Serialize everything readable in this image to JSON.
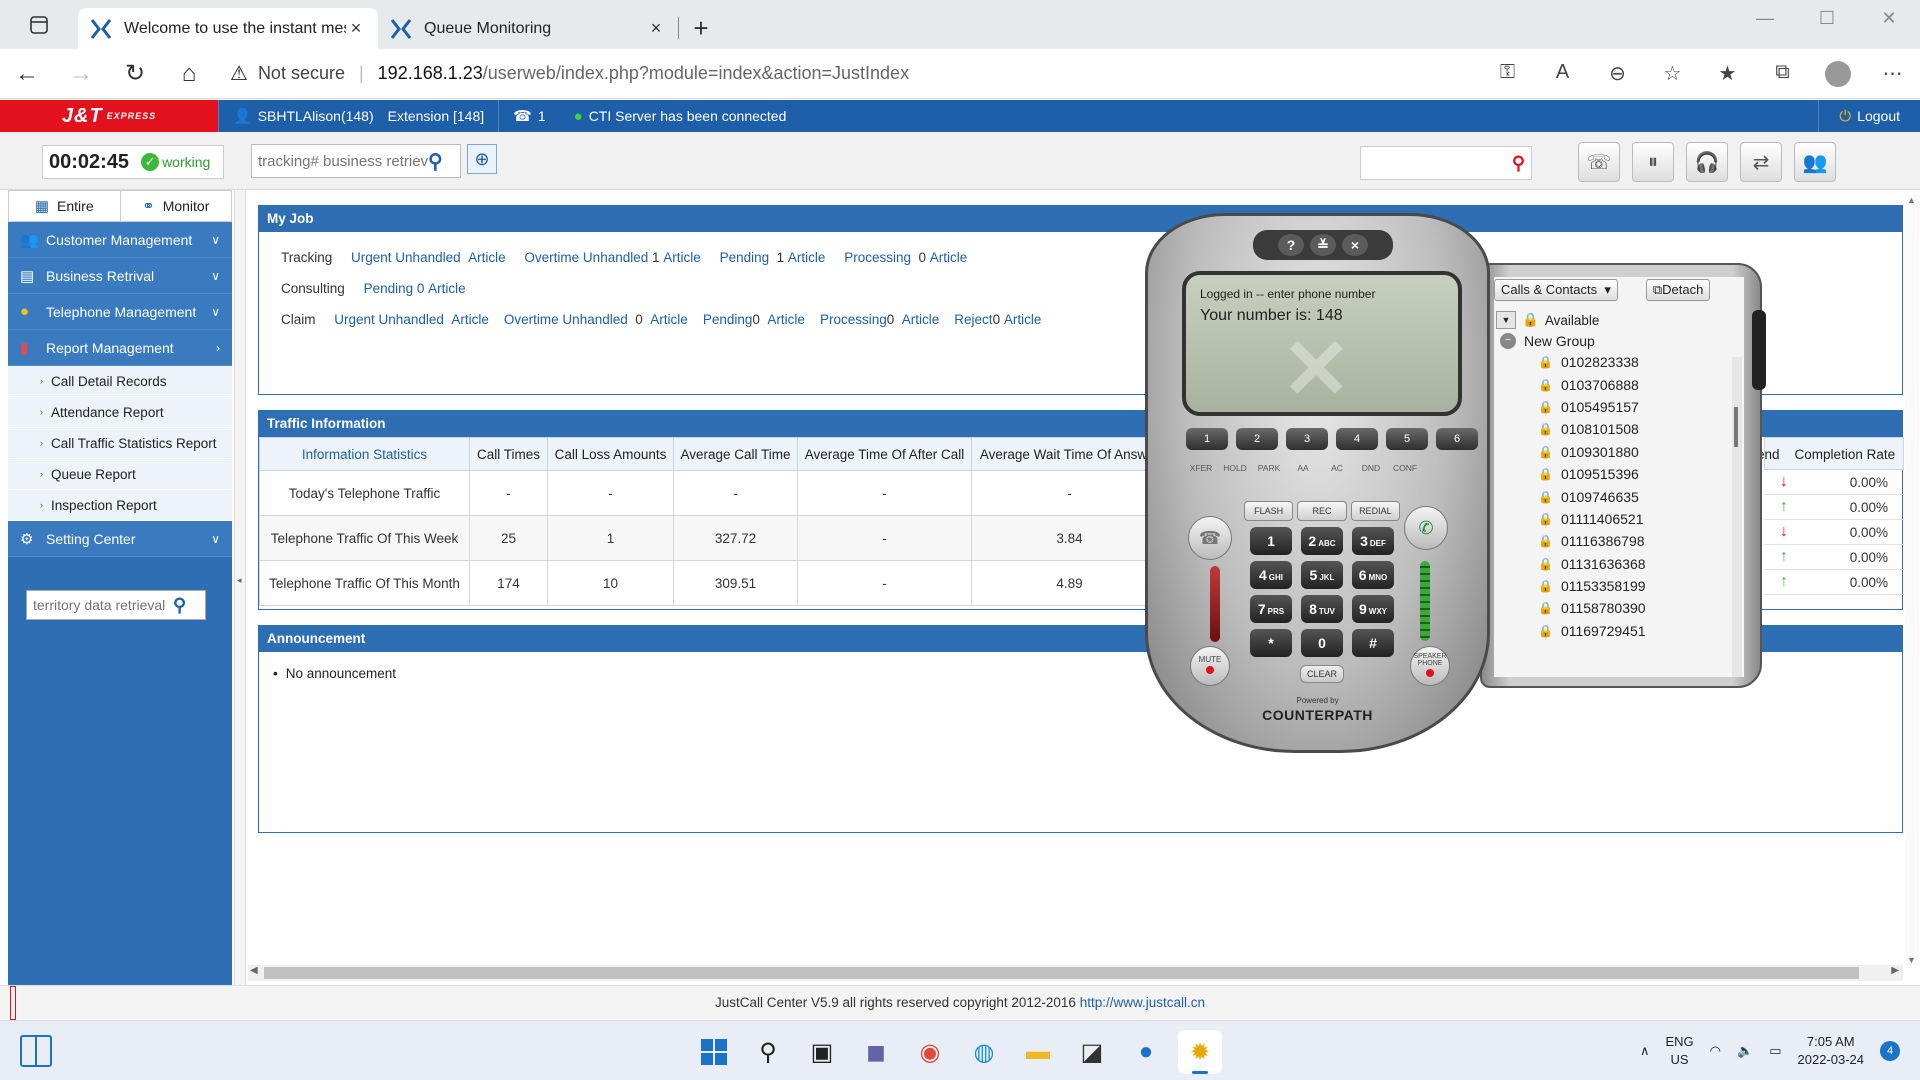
{
  "browser": {
    "tabs": [
      {
        "title": "Welcome to use the instant mes"
      },
      {
        "title": "Queue Monitoring"
      }
    ],
    "url_security": "Not secure",
    "url_host": "192.168.1.23",
    "url_path": "/userweb/index.php?module=index&action=JustIndex"
  },
  "header": {
    "logo": "J&T",
    "logo_sub": "EXPRESS",
    "user": "SBHTLAlison(148)",
    "extension": "Extension [148]",
    "queue_count": "1",
    "cti_status": "CTI Server has been connected",
    "logout": "Logout"
  },
  "toolbar": {
    "timer": "00:02:45",
    "status": "working",
    "tracking_placeholder": "tracking# business retrieve"
  },
  "sidebar": {
    "tab_entire": "Entire",
    "tab_monitor": "Monitor",
    "menus": [
      {
        "label": "Customer Management"
      },
      {
        "label": "Business Retrival"
      },
      {
        "label": "Telephone Management"
      },
      {
        "label": "Report Management"
      }
    ],
    "report_items": [
      "Call Detail Records",
      "Attendance Report",
      "Call Traffic Statistics Report",
      "Queue Report",
      "Inspection Report"
    ],
    "setting_center": "Setting Center",
    "search_placeholder": "territory data retrieval"
  },
  "my_job": {
    "title": "My Job",
    "tracking": {
      "label": "Tracking",
      "urgent": "Urgent Unhandled",
      "urgent_n": "",
      "urgent_unit": "Article",
      "overtime": "Overtime Unhandled",
      "overtime_n": "1",
      "overtime_unit": "Article",
      "pending": "Pending",
      "pending_n": "1",
      "pending_unit": "Article",
      "processing": "Processing",
      "processing_n": "0",
      "processing_unit": "Article"
    },
    "consulting": {
      "label": "Consulting",
      "pending": "Pending",
      "pending_n": "0",
      "pending_unit": "Article"
    },
    "claim": {
      "label": "Claim",
      "urgent": "Urgent Unhandled",
      "urgent_n": "",
      "urgent_unit": "Article",
      "overtime": "Overtime Unhandled",
      "overtime_n": "0",
      "overtime_unit": "Article",
      "pending": "Pending",
      "pending_n": "0",
      "pending_unit": "Article",
      "processing": "Processing",
      "processing_n": "0",
      "processing_unit": "Article",
      "reject": "Reject",
      "reject_n": "0",
      "reject_unit": "Article"
    }
  },
  "traffic": {
    "title": "Traffic Information",
    "headers": [
      "Information Statistics",
      "Call Times",
      "Call Loss Amounts",
      "Average Call Time",
      "Average Time Of After Call",
      "Average Wait Time Of Answer"
    ],
    "rows": [
      [
        "Today's Telephone Traffic",
        "-",
        "-",
        "-",
        "-",
        "-"
      ],
      [
        "Telephone Traffic Of This Week",
        "25",
        "1",
        "327.72",
        "-",
        "3.84"
      ],
      [
        "Telephone Traffic Of This Month",
        "174",
        "10",
        "309.51",
        "-",
        "4.89"
      ]
    ],
    "right_headers": [
      "end",
      "Completion Rate"
    ],
    "completion_rates": [
      "0.00%",
      "0.00%",
      "0.00%",
      "0.00%",
      "0.00%"
    ],
    "trend_arrows": [
      "down",
      "up",
      "down",
      "up",
      "up"
    ]
  },
  "announcement": {
    "title": "Announcement",
    "text": "No announcement"
  },
  "footer": {
    "text": "JustCall Center V5.9 all rights reserved copyright 2012-2016",
    "link": "http://www.justcall.cn"
  },
  "softphone": {
    "top_buttons": [
      "?",
      "≚",
      "×"
    ],
    "lcd_line1": "Logged in -- enter phone number",
    "lcd_line2": "Your number is: 148",
    "mem_keys": [
      "1",
      "2",
      "3",
      "4",
      "5",
      "6"
    ],
    "func_keys": [
      "XFER",
      "HOLD",
      "PARK",
      "AA",
      "AC",
      "DND",
      "CONF"
    ],
    "top_keys": [
      "FLASH",
      "REC",
      "REDIAL"
    ],
    "keys": [
      {
        "d": "1",
        "l": ""
      },
      {
        "d": "2",
        "l": "ABC"
      },
      {
        "d": "3",
        "l": "DEF"
      },
      {
        "d": "4",
        "l": "GHI"
      },
      {
        "d": "5",
        "l": "JKL"
      },
      {
        "d": "6",
        "l": "MNO"
      },
      {
        "d": "7",
        "l": "PRS"
      },
      {
        "d": "8",
        "l": "TUV"
      },
      {
        "d": "9",
        "l": "WXY"
      },
      {
        "d": "*",
        "l": ""
      },
      {
        "d": "0",
        "l": ""
      },
      {
        "d": "#",
        "l": ""
      }
    ],
    "clear": "CLEAR",
    "mute": "MUTE",
    "speaker": "SPEAKER PHONE",
    "powered_by": "Powered by",
    "brand": "COUNTERPATH"
  },
  "contacts": {
    "dropdown": "Calls & Contacts",
    "detach": "Detach",
    "status": "Available",
    "group": "New Group",
    "numbers": [
      "0102823338",
      "0103706888",
      "0105495157",
      "0108101508",
      "0109301880",
      "0109515396",
      "0109746635",
      "01111406521",
      "01116386798",
      "01131636368",
      "01153358199",
      "01158780390",
      "01169729451"
    ]
  },
  "taskbar": {
    "lang_1": "ENG",
    "lang_2": "US",
    "time": "7:05 AM",
    "date": "2022-03-24",
    "badge": "4"
  }
}
